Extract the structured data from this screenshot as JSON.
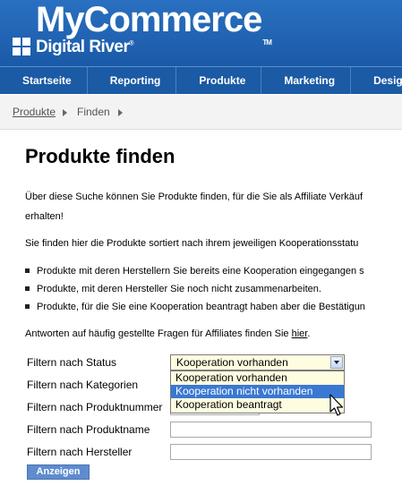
{
  "header": {
    "brand": "MyCommerce",
    "brand_tm": "TM",
    "company": "Digital River",
    "company_reg": "®"
  },
  "nav": {
    "items": [
      "Startseite",
      "Reporting",
      "Produkte",
      "Marketing",
      "Design und La"
    ]
  },
  "breadcrumb": {
    "items": [
      "Produkte",
      "Finden"
    ]
  },
  "main": {
    "title": "Produkte finden",
    "intro_line1": "Über diese Suche können Sie Produkte finden, für die Sie als Affiliate Verkäuf",
    "intro_line2": "erhalten!",
    "sort_text": "Sie finden hier die Produkte sortiert nach ihrem jeweiligen Kooperationsstatu",
    "bullets": [
      "Produkte mit deren Herstellern Sie bereits eine Kooperation eingegangen s",
      "Produkte, mit deren Hersteller Sie noch nicht zusammenarbeiten.",
      "Produkte, für die Sie eine Kooperation beantragt haben aber die Bestätigun"
    ],
    "faq_text": "Antworten auf häufig gestellte Fragen für Affiliates finden Sie ",
    "faq_link": "hier",
    "faq_end": "."
  },
  "filters": {
    "status_label": "Filtern nach Status",
    "status_selected": "Kooperation vorhanden",
    "status_options": [
      "Kooperation vorhanden",
      "Kooperation nicht vorhanden",
      "Kooperation beantragt"
    ],
    "status_highlighted": "Kooperation nicht vorhanden",
    "category_label": "Filtern nach Kategorien",
    "product_number_label": "Filtern nach Produktnummer",
    "product_number_value": "",
    "product_name_label": "Filtern nach Produktname",
    "product_name_value": "",
    "manufacturer_label": "Filtern nach Hersteller",
    "manufacturer_value": "",
    "submit": "Anzeigen"
  },
  "colors": {
    "header_blue": "#1f63b3",
    "nav_blue": "#1b5aa5",
    "select_bg": "#fffde0",
    "highlight": "#3a78d2",
    "button": "#5f8ccf"
  }
}
